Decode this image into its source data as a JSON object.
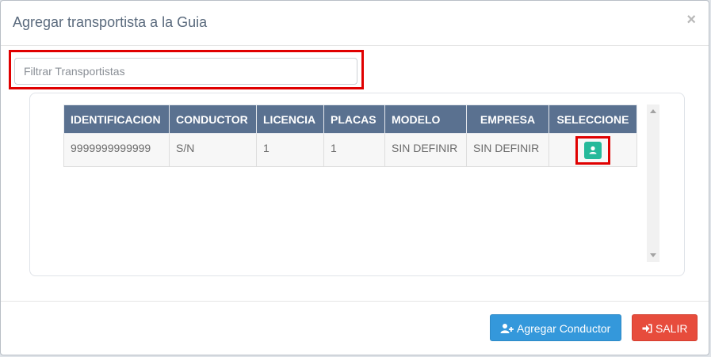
{
  "modal": {
    "title": "Agregar transportista a la Guia",
    "close_label": "×"
  },
  "filter": {
    "placeholder": "Filtrar Transportistas",
    "value": ""
  },
  "table": {
    "columns": [
      "IDENTIFICACION",
      "CONDUCTOR",
      "LICENCIA",
      "PLACAS",
      "MODELO",
      "EMPRESA",
      "SELECCIONE"
    ],
    "rows": [
      {
        "identificacion": "9999999999999",
        "conductor": "S/N",
        "licencia": "1",
        "placas": "1",
        "modelo": "SIN DEFINIR",
        "empresa": "SIN DEFINIR",
        "select_icon": "user-icon"
      }
    ]
  },
  "footer": {
    "add_driver_label": "Agregar Conductor",
    "add_driver_icon": "user-plus-icon",
    "exit_label": "SALIR",
    "exit_icon": "sign-in-icon"
  },
  "colors": {
    "header_bg": "#5a7190",
    "select_button": "#26b99a",
    "primary_button": "#3498db",
    "danger_button": "#e74c3c",
    "highlight": "#e00000"
  }
}
